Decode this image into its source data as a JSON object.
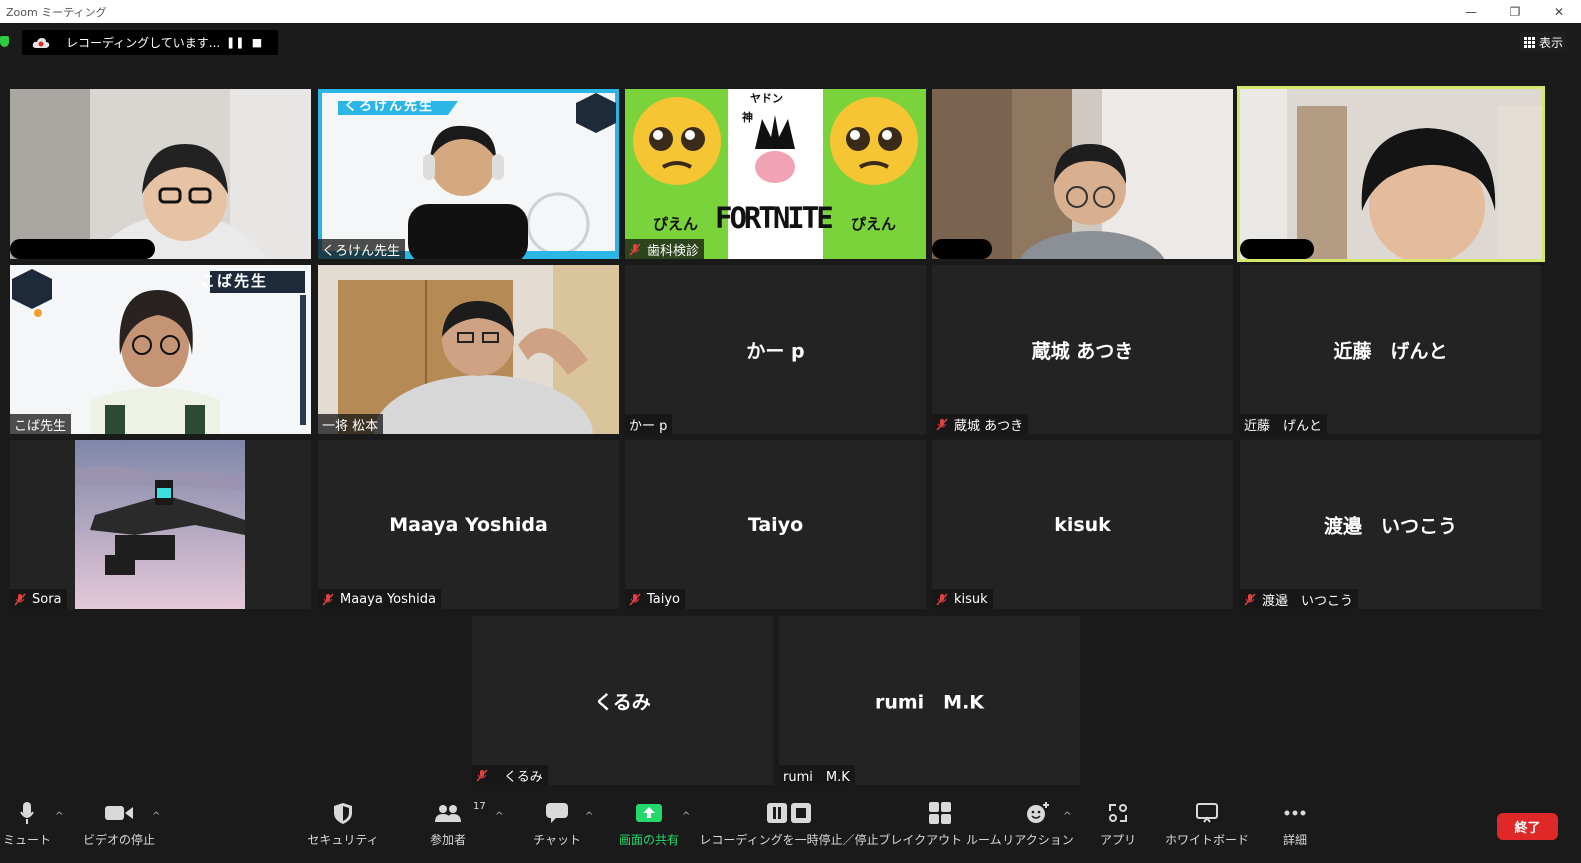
{
  "window": {
    "title": "Zoom ミーティング"
  },
  "recording": {
    "text": "レコーディングしています..."
  },
  "view_label": "表示",
  "tiles": [
    {
      "name": "",
      "redacted": true
    },
    {
      "name": "くろけん先生"
    },
    {
      "name": "歯科検診",
      "muted": true
    },
    {
      "name": "",
      "redacted": true
    },
    {
      "name": "",
      "redacted": true
    },
    {
      "name": "こば先生"
    },
    {
      "name": "一将 松本"
    },
    {
      "name": "かー p",
      "display_name": "かー p"
    },
    {
      "name": "蔵城 あつき",
      "display_name": "蔵城 あつき",
      "muted": true
    },
    {
      "name": "近藤　げんと",
      "display_name": "近藤　げんと"
    },
    {
      "name": "Sora",
      "muted": true
    },
    {
      "name": "Maaya Yoshida",
      "display_name": "Maaya Yoshida",
      "muted": true
    },
    {
      "name": "Taiyo",
      "display_name": "Taiyo",
      "muted": true
    },
    {
      "name": "kisuk",
      "display_name": "kisuk",
      "muted": true
    },
    {
      "name": "渡邉　いつこう",
      "display_name": "渡邉　いつこう",
      "muted": true
    },
    {
      "name": "くるみ",
      "display_name": "くるみ",
      "muted": true
    },
    {
      "name": "rumi　M.K",
      "display_name": "rumi　M.K"
    }
  ],
  "tile_overlays": {
    "kuroken_banner": "くろけん先生",
    "koba_banner": "こば先生",
    "shika_top": "ヤドン",
    "shika_god": "神",
    "shika_pien_left": "ぴえん",
    "shika_fortnite": "FORTNITE",
    "shika_pien_right": "ぴえん"
  },
  "toolbar": {
    "mute": "ミュート",
    "video": "ビデオの停止",
    "security": "セキュリティ",
    "participants": "参加者",
    "participants_count": "17",
    "chat": "チャット",
    "share": "画面の共有",
    "recording": "レコーディングを一時停止／停止",
    "breakout": "ブレイクアウト ルーム",
    "reactions": "リアクション",
    "apps": "アプリ",
    "whiteboard": "ホワイトボード",
    "more": "詳細",
    "end": "終了"
  },
  "colors": {
    "accent_green": "#23d96b",
    "end_red": "#e02828",
    "active_speaker": "#d6e86b"
  }
}
